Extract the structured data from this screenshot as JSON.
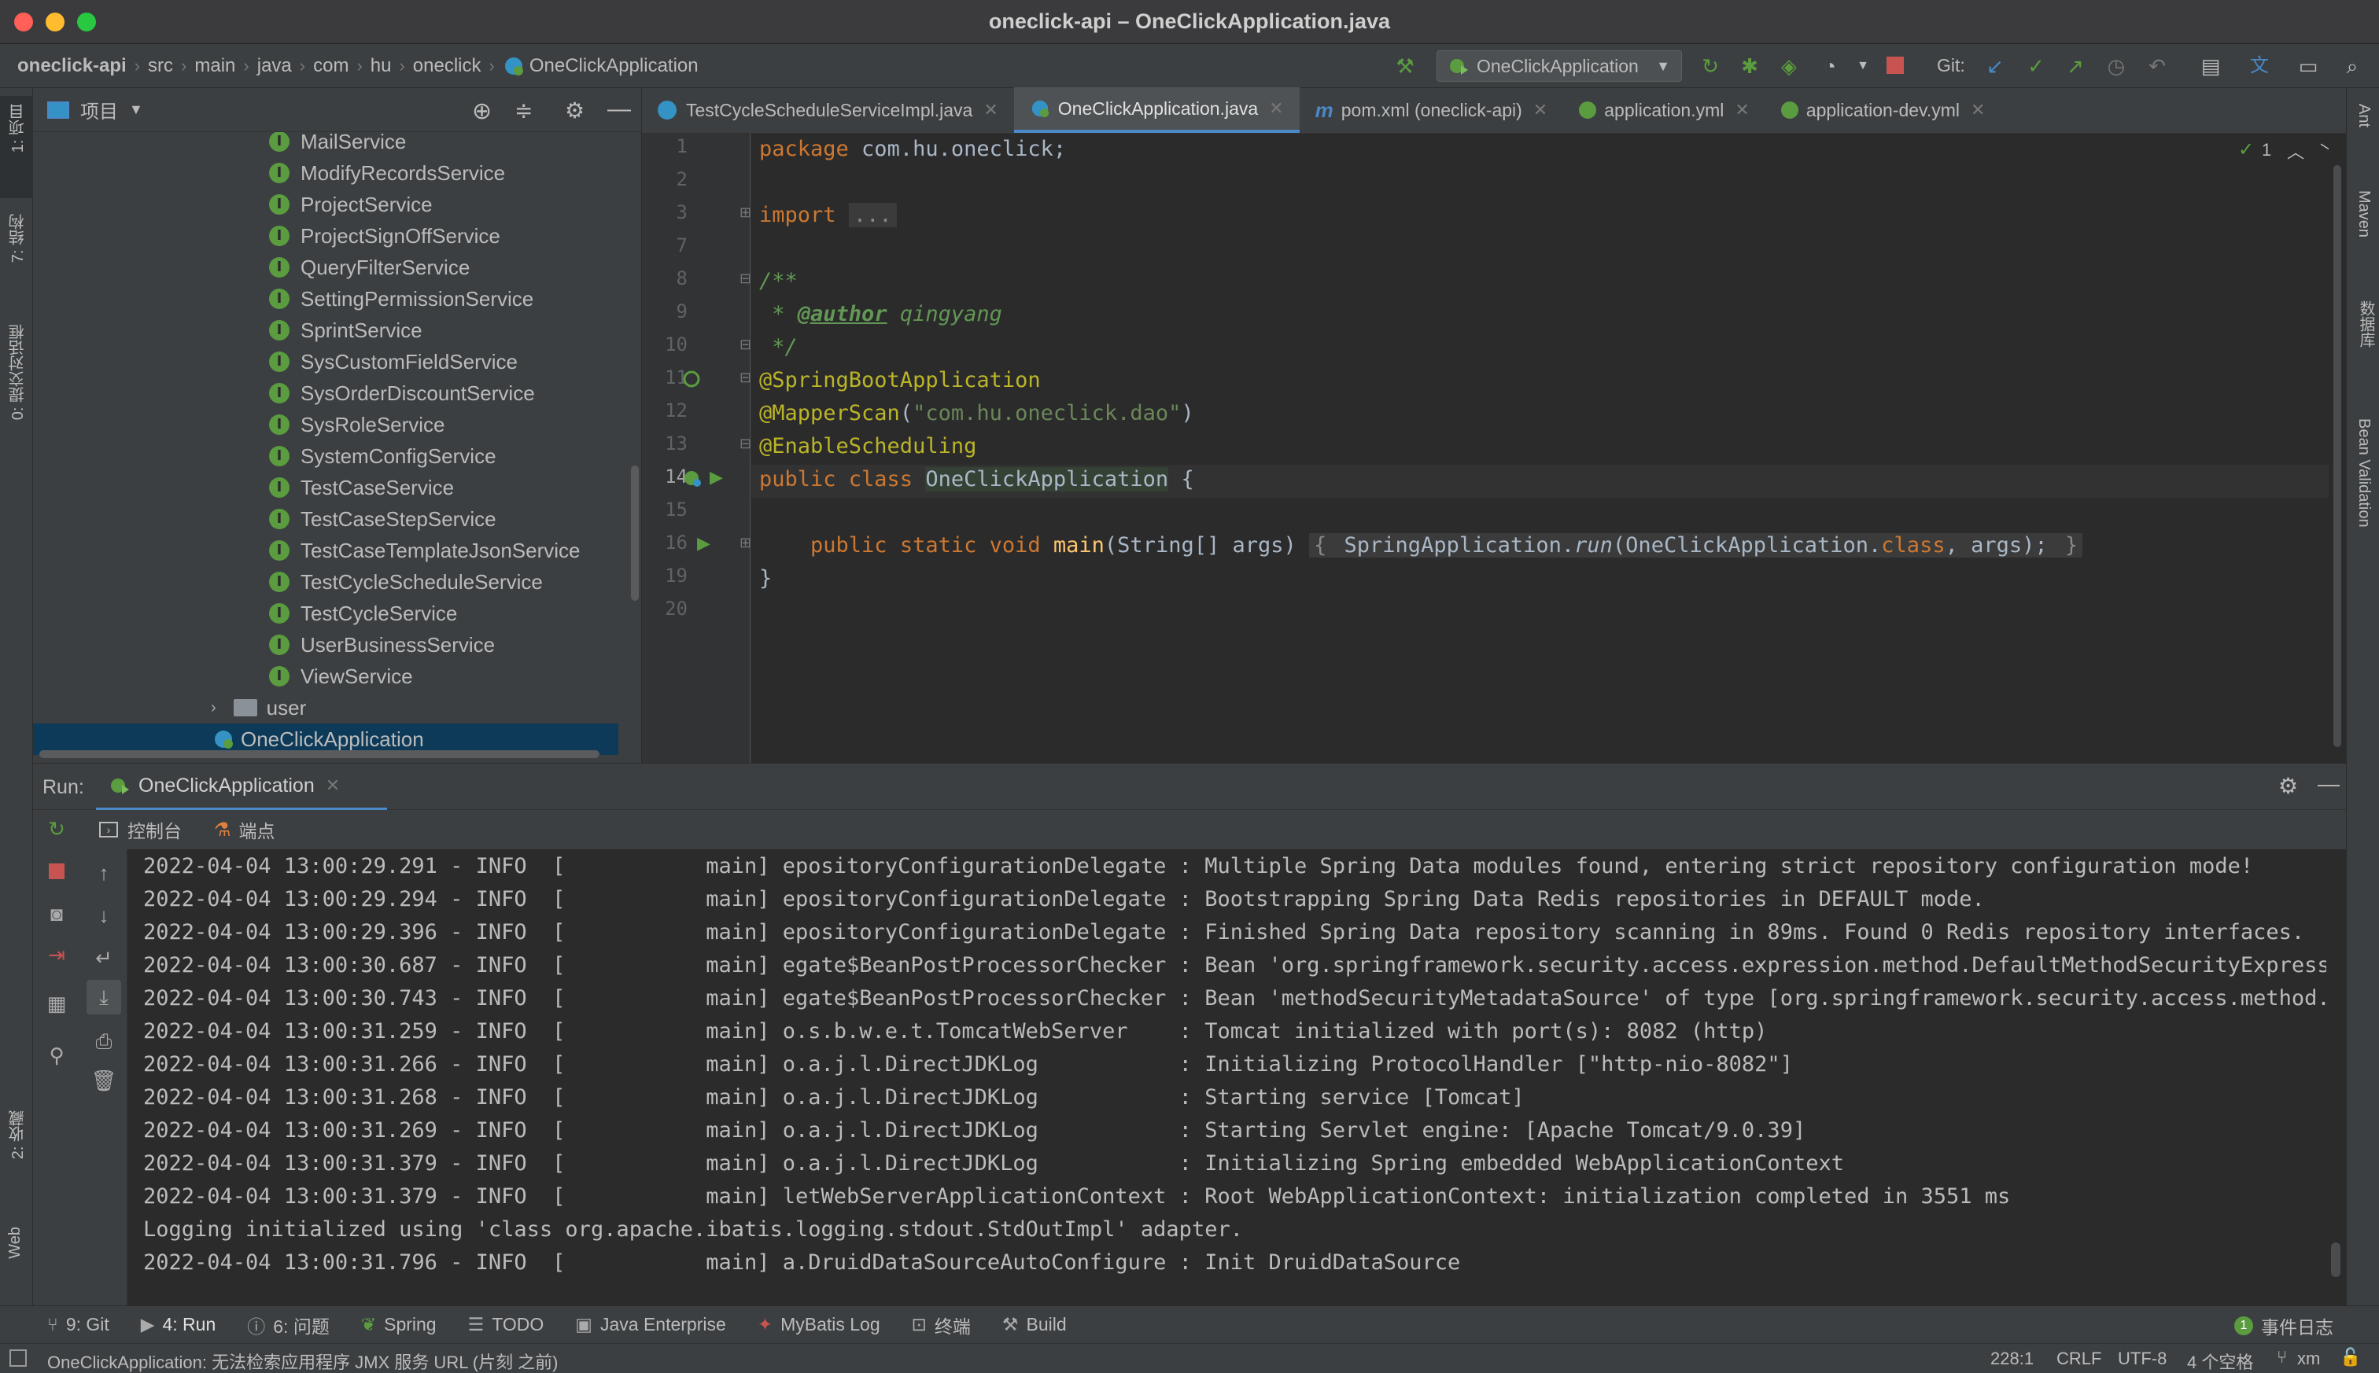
{
  "window": {
    "title": "oneclick-api – OneClickApplication.java"
  },
  "breadcrumb": [
    "oneclick-api",
    "src",
    "main",
    "java",
    "com",
    "hu",
    "oneclick",
    "OneClickApplication"
  ],
  "run_config": "OneClickApplication",
  "git_label": "Git:",
  "left_stripe": {
    "project": "1: 项目",
    "structure": "7: 结构",
    "commit": "0: 提交对话框",
    "favorites": "2: 收藏",
    "web": "Web"
  },
  "right_stripe": {
    "ant": "Ant",
    "maven": "Maven",
    "database": "数据库",
    "bean": "Bean Validation"
  },
  "project_panel": {
    "title": "项目",
    "items": [
      "MailService",
      "ModifyRecordsService",
      "ProjectService",
      "ProjectSignOffService",
      "QueryFilterService",
      "SettingPermissionService",
      "SprintService",
      "SysCustomFieldService",
      "SysOrderDiscountService",
      "SysRoleService",
      "SystemConfigService",
      "TestCaseService",
      "TestCaseStepService",
      "TestCaseTemplateJsonService",
      "TestCycleScheduleService",
      "TestCycleService",
      "UserBusinessService",
      "ViewService"
    ],
    "folder": "user",
    "selected": "OneClickApplication",
    "interface_badge": "I"
  },
  "editor": {
    "tabs": [
      "TestCycleScheduleServiceImpl.java",
      "OneClickApplication.java",
      "pom.xml (oneclick-api)",
      "application.yml",
      "application-dev.yml"
    ],
    "line_numbers": [
      "1",
      "2",
      "3",
      "7",
      "8",
      "9",
      "10",
      "11",
      "12",
      "13",
      "14",
      "15",
      "16",
      "19",
      "20"
    ],
    "inspection_count": "1",
    "code": {
      "l1_kw": "package",
      "l1_rest": " com.hu.oneclick;",
      "l3_kw": "import",
      "l3_fold": "...",
      "l8": "/**",
      "l9_star": " * ",
      "l9_tag": "@author",
      "l9_name": " qingyang",
      "l10": " */",
      "l11": "@SpringBootApplication",
      "l12_ann": "@MapperScan",
      "l12_open": "(",
      "l12_str": "\"com.hu.oneclick.dao\"",
      "l12_close": ")",
      "l13": "@EnableScheduling",
      "l14_kw": "public class ",
      "l14_name": "OneClickApplication",
      "l14_rest": " {",
      "l16_kw": "public static void ",
      "l16_fn": "main",
      "l16_args": "(String[] args) ",
      "l16_ob": "{ ",
      "l16_body1": "SpringApplication.",
      "l16_run": "run",
      "l16_body2": "(OneClickApplication.",
      "l16_class": "class",
      "l16_body3": ", args);",
      "l16_cb": " }",
      "l19": "}"
    }
  },
  "run": {
    "label": "Run:",
    "tab": "OneClickApplication",
    "subtabs": [
      "控制台",
      "端点"
    ],
    "log": [
      "2022-04-04 13:00:29.291 - INFO  [           main] epositoryConfigurationDelegate : Multiple Spring Data modules found, entering strict repository configuration mode!",
      "2022-04-04 13:00:29.294 - INFO  [           main] epositoryConfigurationDelegate : Bootstrapping Spring Data Redis repositories in DEFAULT mode.",
      "2022-04-04 13:00:29.396 - INFO  [           main] epositoryConfigurationDelegate : Finished Spring Data repository scanning in 89ms. Found 0 Redis repository interfaces.",
      "2022-04-04 13:00:30.687 - INFO  [           main] egate$BeanPostProcessorChecker : Bean 'org.springframework.security.access.expression.method.DefaultMethodSecurityExpressionHandler'",
      "2022-04-04 13:00:30.743 - INFO  [           main] egate$BeanPostProcessorChecker : Bean 'methodSecurityMetadataSource' of type [org.springframework.security.access.method.DelegatingMethodSecurityMetadataSource]",
      "2022-04-04 13:00:31.259 - INFO  [           main] o.s.b.w.e.t.TomcatWebServer    : Tomcat initialized with port(s): 8082 (http)",
      "2022-04-04 13:00:31.266 - INFO  [           main] o.a.j.l.DirectJDKLog           : Initializing ProtocolHandler [\"http-nio-8082\"]",
      "2022-04-04 13:00:31.268 - INFO  [           main] o.a.j.l.DirectJDKLog           : Starting service [Tomcat]",
      "2022-04-04 13:00:31.269 - INFO  [           main] o.a.j.l.DirectJDKLog           : Starting Servlet engine: [Apache Tomcat/9.0.39]",
      "2022-04-04 13:00:31.379 - INFO  [           main] o.a.j.l.DirectJDKLog           : Initializing Spring embedded WebApplicationContext",
      "2022-04-04 13:00:31.379 - INFO  [           main] letWebServerApplicationContext : Root WebApplicationContext: initialization completed in 3551 ms",
      "Logging initialized using 'class org.apache.ibatis.logging.stdout.StdOutImpl' adapter.",
      "2022-04-04 13:00:31.796 - INFO  [           main] a.DruidDataSourceAutoConfigure : Init DruidDataSource"
    ]
  },
  "bottom_tools": [
    "9: Git",
    "4: Run",
    "6: 问题",
    "Spring",
    "TODO",
    "Java Enterprise",
    "MyBatis Log",
    "终端",
    "Build"
  ],
  "event_log": {
    "count": "1",
    "label": "事件日志"
  },
  "status": {
    "message": "OneClickApplication: 无法检索应用程序 JMX 服务 URL (片刻 之前)",
    "position": "228:1",
    "line_sep": "CRLF",
    "encoding": "UTF-8",
    "indent": "4 个空格",
    "branch": "xm"
  },
  "colors": {
    "accent": "#4a88c7",
    "green": "#5a9c3f",
    "red": "#c75450"
  }
}
